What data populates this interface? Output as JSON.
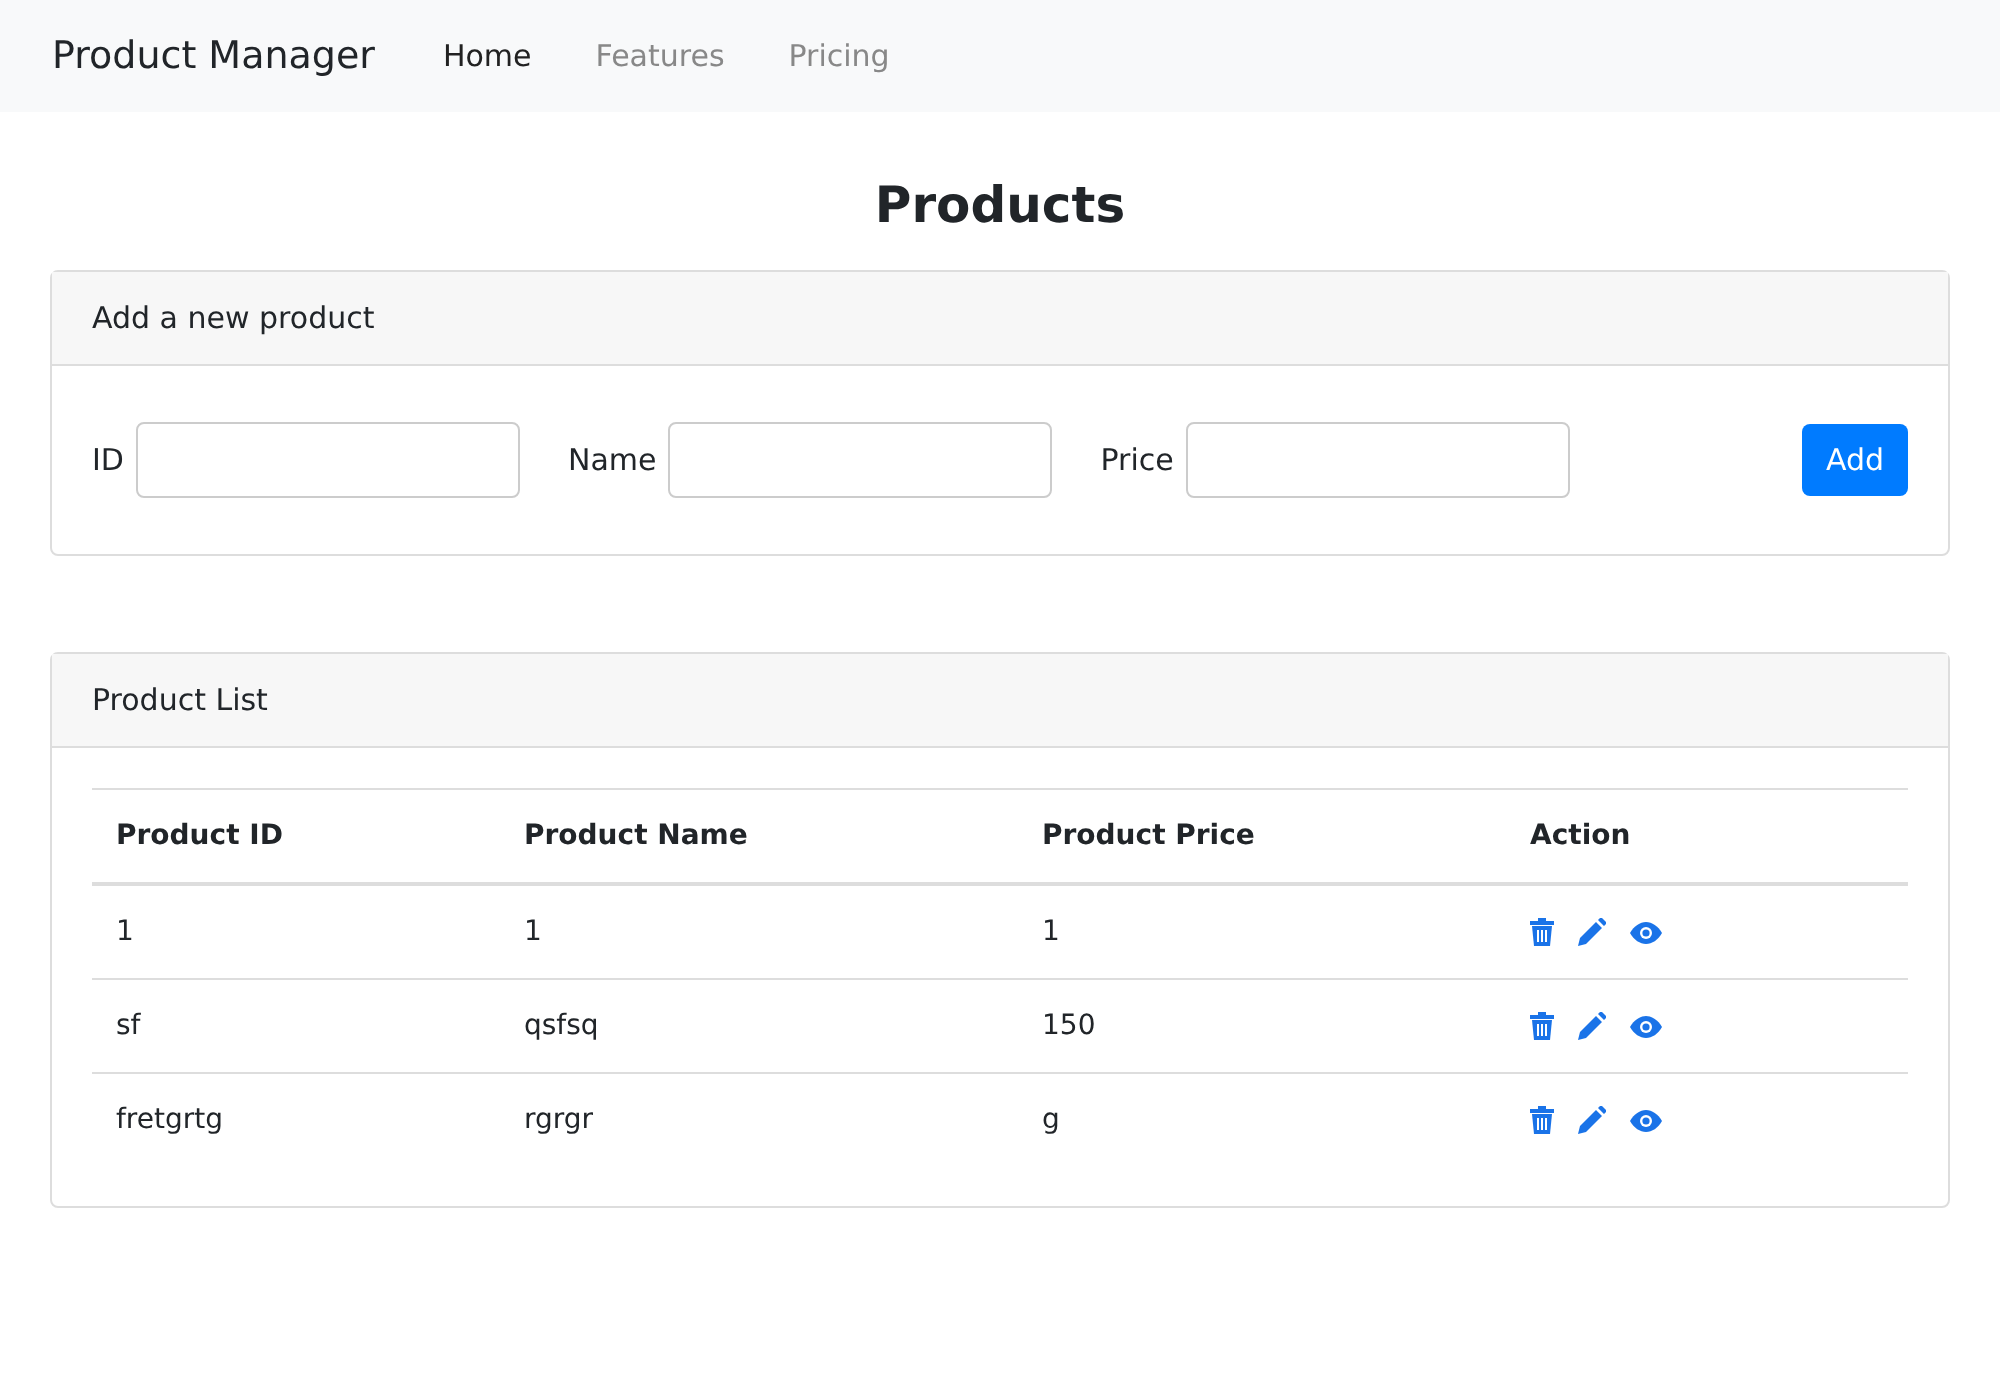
{
  "navbar": {
    "brand": "Product Manager",
    "links": [
      {
        "label": "Home",
        "selected": true
      },
      {
        "label": "Features",
        "selected": false
      },
      {
        "label": "Pricing",
        "selected": false
      }
    ]
  },
  "title": "Products",
  "add_card": {
    "header": "Add a new product",
    "fields": [
      {
        "label": "ID"
      },
      {
        "label": "Name"
      },
      {
        "label": "Price"
      }
    ],
    "button": "Add"
  },
  "list_card": {
    "header": "Product List",
    "columns": [
      "Product ID",
      "Product Name",
      "Product Price",
      "Action"
    ],
    "rows": [
      [
        "1",
        "1",
        "1"
      ],
      [
        "sf",
        "qsfsq",
        "150"
      ],
      [
        "fretgrtg",
        "rgrgr",
        "g"
      ]
    ]
  }
}
